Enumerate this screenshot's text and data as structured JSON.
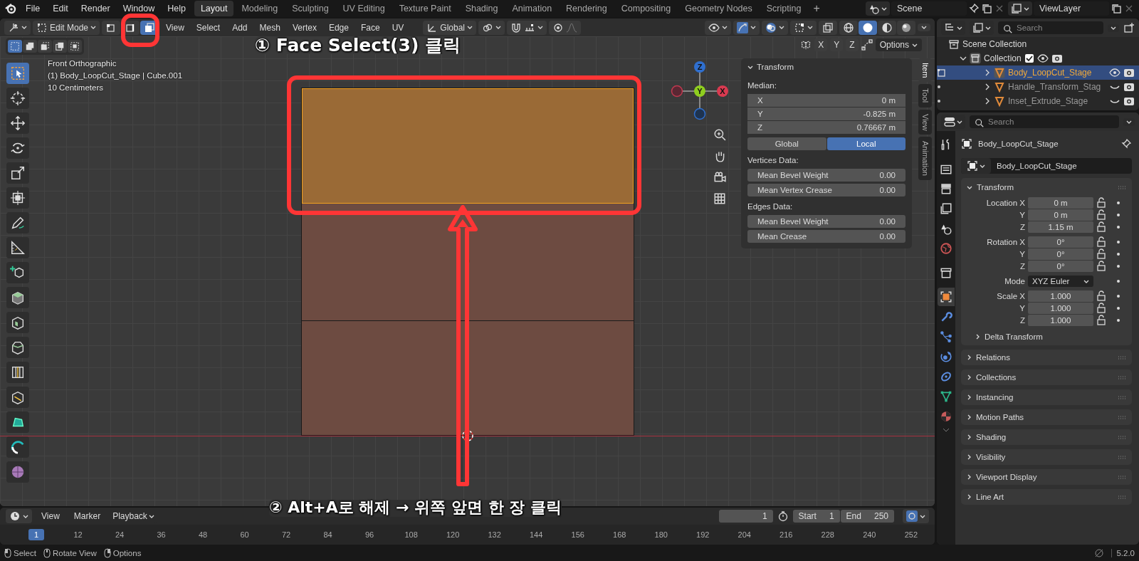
{
  "top_bar": {
    "menus": [
      "File",
      "Edit",
      "Render",
      "Window",
      "Help"
    ],
    "workspaces": [
      {
        "label": "Layout",
        "selected": true
      },
      {
        "label": "Modeling",
        "selected": false
      },
      {
        "label": "Sculpting",
        "selected": false
      },
      {
        "label": "UV Editing",
        "selected": false
      },
      {
        "label": "Texture Paint",
        "selected": false
      },
      {
        "label": "Shading",
        "selected": false
      },
      {
        "label": "Animation",
        "selected": false
      },
      {
        "label": "Rendering",
        "selected": false
      },
      {
        "label": "Compositing",
        "selected": false
      },
      {
        "label": "Geometry Nodes",
        "selected": false
      },
      {
        "label": "Scripting",
        "selected": false
      }
    ],
    "add_workspace": "+",
    "scene": "Scene",
    "view_layer": "ViewLayer"
  },
  "viewport": {
    "header": {
      "mode": "Edit Mode",
      "select_modes": [
        {
          "kind": "vertex",
          "selected": false
        },
        {
          "kind": "edge",
          "selected": false
        },
        {
          "kind": "face",
          "selected": true
        }
      ],
      "menus": [
        "View",
        "Select",
        "Add",
        "Mesh",
        "Vertex",
        "Edge",
        "Face",
        "UV"
      ],
      "orientation": "Global",
      "shading_modes": [
        {
          "kind": "wireframe",
          "selected": false
        },
        {
          "kind": "solid",
          "selected": true
        },
        {
          "kind": "material",
          "selected": false
        },
        {
          "kind": "rendered",
          "selected": false
        }
      ]
    },
    "select_box_modes": [
      {
        "selected": true
      },
      {
        "selected": false
      },
      {
        "selected": false
      },
      {
        "selected": false
      },
      {
        "selected": false
      }
    ],
    "mirror_axes": [
      {
        "label": "X",
        "selected": false
      },
      {
        "label": "Y",
        "selected": false
      },
      {
        "label": "Z",
        "selected": false
      }
    ],
    "options": "Options",
    "info": [
      "Front Orthographic",
      "(1) Body_LoopCut_Stage | Cube.001",
      "10 Centimeters"
    ],
    "tools": [
      {
        "kind": "select",
        "selected": true
      },
      {
        "kind": "cursor",
        "selected": false
      },
      {
        "kind": "move",
        "selected": false
      },
      {
        "kind": "rotate",
        "selected": false
      },
      {
        "kind": "scale",
        "selected": false
      },
      {
        "kind": "transform",
        "selected": false
      },
      {
        "kind": "annotate",
        "selected": false
      },
      {
        "kind": "measure",
        "selected": false
      },
      {
        "kind": "add",
        "selected": false
      },
      {
        "kind": "extrude",
        "selected": false
      },
      {
        "kind": "inset",
        "selected": false
      },
      {
        "kind": "bevel",
        "selected": false
      },
      {
        "kind": "loopcut",
        "selected": false
      },
      {
        "kind": "knife",
        "selected": false
      },
      {
        "kind": "polybuild",
        "selected": false
      },
      {
        "kind": "spin",
        "selected": false
      },
      {
        "kind": "smooth",
        "selected": false
      }
    ],
    "gizmo": {
      "z": "Z",
      "y": "Y",
      "x": "X"
    },
    "sidebar": {
      "tabs": [
        {
          "label": "Item",
          "selected": true
        },
        {
          "label": "Tool",
          "selected": false
        },
        {
          "label": "View",
          "selected": false
        },
        {
          "label": "Animation",
          "selected": false
        }
      ],
      "panel_title": "Transform",
      "median_label": "Median:",
      "median": [
        {
          "label": "X",
          "value": "0 m"
        },
        {
          "label": "Y",
          "value": "-0.825 m"
        },
        {
          "label": "Z",
          "value": "0.76667 m"
        }
      ],
      "space": [
        {
          "label": "Global",
          "selected": false
        },
        {
          "label": "Local",
          "selected": true
        }
      ],
      "sections": [
        {
          "title": "Vertices Data:",
          "fields": [
            {
              "label": "Mean Bevel Weight",
              "value": "0.00"
            },
            {
              "label": "Mean Vertex Crease",
              "value": "0.00"
            }
          ]
        },
        {
          "title": "Edges Data:",
          "fields": [
            {
              "label": "Mean Bevel Weight",
              "value": "0.00"
            },
            {
              "label": "Mean Crease",
              "value": "0.00"
            }
          ]
        }
      ]
    }
  },
  "annotations": [
    {
      "kind": "viewport",
      "text": "① Face Select(3) 클릭"
    },
    {
      "kind": "timeline",
      "text": "② Alt+A로 해제 → 위쪽 앞면 한 장 클릭"
    }
  ],
  "timeline": {
    "menus": [
      "View",
      "Marker",
      "Playback"
    ],
    "current_frame": "1",
    "start_label": "Start",
    "start": "1",
    "end_label": "End",
    "end": "250",
    "ruler": [
      {
        "label": "1",
        "selected": true
      },
      {
        "label": "12",
        "selected": false
      },
      {
        "label": "24",
        "selected": false
      },
      {
        "label": "36",
        "selected": false
      },
      {
        "label": "48",
        "selected": false
      },
      {
        "label": "60",
        "selected": false
      },
      {
        "label": "72",
        "selected": false
      },
      {
        "label": "84",
        "selected": false
      },
      {
        "label": "96",
        "selected": false
      },
      {
        "label": "108",
        "selected": false
      },
      {
        "label": "120",
        "selected": false
      },
      {
        "label": "132",
        "selected": false
      },
      {
        "label": "144",
        "selected": false
      },
      {
        "label": "156",
        "selected": false
      },
      {
        "label": "168",
        "selected": false
      },
      {
        "label": "180",
        "selected": false
      },
      {
        "label": "192",
        "selected": false
      },
      {
        "label": "204",
        "selected": false
      },
      {
        "label": "216",
        "selected": false
      },
      {
        "label": "228",
        "selected": false
      },
      {
        "label": "240",
        "selected": false
      },
      {
        "label": "252",
        "selected": false
      }
    ]
  },
  "outliner": {
    "search_placeholder": "Search",
    "tree": [
      {
        "label": "Scene Collection",
        "kind": "scene",
        "children": [
          {
            "label": "Collection",
            "kind": "collection",
            "checked": true,
            "expanded": true,
            "children": [
              {
                "label": "Body_LoopCut_Stage",
                "kind": "mesh",
                "expanded": false,
                "selected": true,
                "visible": true
              },
              {
                "label": "Handle_Transform_Stag",
                "kind": "mesh",
                "expanded": false,
                "selected": false,
                "visible": false
              },
              {
                "label": "Inset_Extrude_Stage",
                "kind": "mesh",
                "expanded": false,
                "selected": false,
                "visible": false
              }
            ]
          }
        ]
      }
    ]
  },
  "properties": {
    "search_placeholder": "Search",
    "tabs": [
      {
        "kind": "tool",
        "selected": false
      },
      {
        "kind": "render",
        "selected": false
      },
      {
        "kind": "output",
        "selected": false
      },
      {
        "kind": "viewlayer",
        "selected": false
      },
      {
        "kind": "scene",
        "selected": false
      },
      {
        "kind": "world",
        "selected": false
      },
      {
        "kind": "collection",
        "selected": false
      },
      {
        "kind": "object",
        "selected": true
      },
      {
        "kind": "modifier",
        "selected": false
      },
      {
        "kind": "particles",
        "selected": false
      },
      {
        "kind": "physics",
        "selected": false
      },
      {
        "kind": "constraint",
        "selected": false
      },
      {
        "kind": "data",
        "selected": false
      },
      {
        "kind": "material",
        "selected": false
      }
    ],
    "object_name": "Body_LoopCut_Stage",
    "name_field": "Body_LoopCut_Stage",
    "transform": {
      "title": "Transform",
      "groups": [
        [
          {
            "label": "Location X",
            "value": "0 m",
            "kind": "number"
          },
          {
            "label": "Y",
            "value": "0 m",
            "kind": "number"
          },
          {
            "label": "Z",
            "value": "1.15 m",
            "kind": "number"
          }
        ],
        [
          {
            "label": "Rotation X",
            "value": "0°",
            "kind": "number"
          },
          {
            "label": "Y",
            "value": "0°",
            "kind": "number"
          },
          {
            "label": "Z",
            "value": "0°",
            "kind": "number"
          }
        ],
        [
          {
            "label": "Mode",
            "value": "XYZ Euler",
            "kind": "dropdown"
          }
        ],
        [
          {
            "label": "Scale X",
            "value": "1.000",
            "kind": "number"
          },
          {
            "label": "Y",
            "value": "1.000",
            "kind": "number"
          },
          {
            "label": "Z",
            "value": "1.000",
            "kind": "number"
          }
        ]
      ],
      "subpanel": "Delta Transform"
    },
    "panels": [
      "Relations",
      "Collections",
      "Instancing",
      "Motion Paths",
      "Shading",
      "Visibility",
      "Viewport Display",
      "Line Art"
    ]
  },
  "status_bar": {
    "hints": [
      "Select",
      "Rotate View",
      "Options"
    ],
    "version": "5.2.0"
  }
}
